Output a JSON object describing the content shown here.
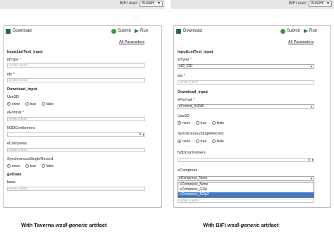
{
  "left": {
    "topbar": {
      "bifi_label": "BIFI user:",
      "user": "XuseR"
    },
    "header": {
      "download_label": "Download",
      "submit_label": "Submit",
      "run_label": "Run",
      "all_params": "All Parameters"
    },
    "section1": "InputListText_input",
    "idtype_label": "idType",
    "idtype_placeholder": "<enter a text>",
    "ids_label": "ids",
    "ids_placeholder": "<enter a text>",
    "section2": "Download_input",
    "use3d_label": "Use3D",
    "radio_none": "none",
    "radio_true": "true",
    "radio_false": "false",
    "eformat_label": "eFormat",
    "eformat_placeholder": "<enter a text>",
    "n3d_label": "N3DConformers",
    "n3d_value": "0",
    "ecompress_label": "eCompress",
    "ecompress_placeholder": "<enter a text>",
    "syncsingle_label": "SynchronousSingleRecord",
    "section3": "getData",
    "base_label": "base",
    "base_placeholder": "<enter a text>",
    "caption_prefix": "With Taverna ",
    "caption_em": "wsdl-generic",
    "caption_suffix": " artifact"
  },
  "right": {
    "topbar": {
      "bifi_label": "BIFI user:",
      "user": "XuseR"
    },
    "header": {
      "download_label": "Download",
      "submit_label": "Submit",
      "run_label": "Run",
      "all_params": "All Parameters"
    },
    "section1": "InputListText_input",
    "idtype_label": "idType",
    "idtype_value": "eID_CID",
    "ids_label": "ids",
    "ids_placeholder": "<enter a text>",
    "section2": "Download_input",
    "eformat_label": "eFormat",
    "eformat_value": "eFormat_ASNB",
    "use3d_label": "Use3D",
    "radio_none": "none",
    "radio_true": "true",
    "radio_false": "false",
    "syncsingle_label": "SynchronousSingleRecord",
    "n3d_label": "N3DConformers",
    "n3d_value": "0",
    "ecompress_label": "eCompress",
    "ecompress_value": "eCompress_None",
    "ecompress_options": [
      "eCompress_None",
      "eCompress_GZip",
      "eCompress_BZip2"
    ],
    "trailing_placeholder": "<enter a text>",
    "caption_prefix": "With BIFI ",
    "caption_em": "wsdl-generic",
    "caption_suffix": " artifact"
  },
  "colors": {
    "selected_option": "#3d78c7",
    "required_star": "#d21111",
    "icon_green": "#2e6b3a"
  }
}
